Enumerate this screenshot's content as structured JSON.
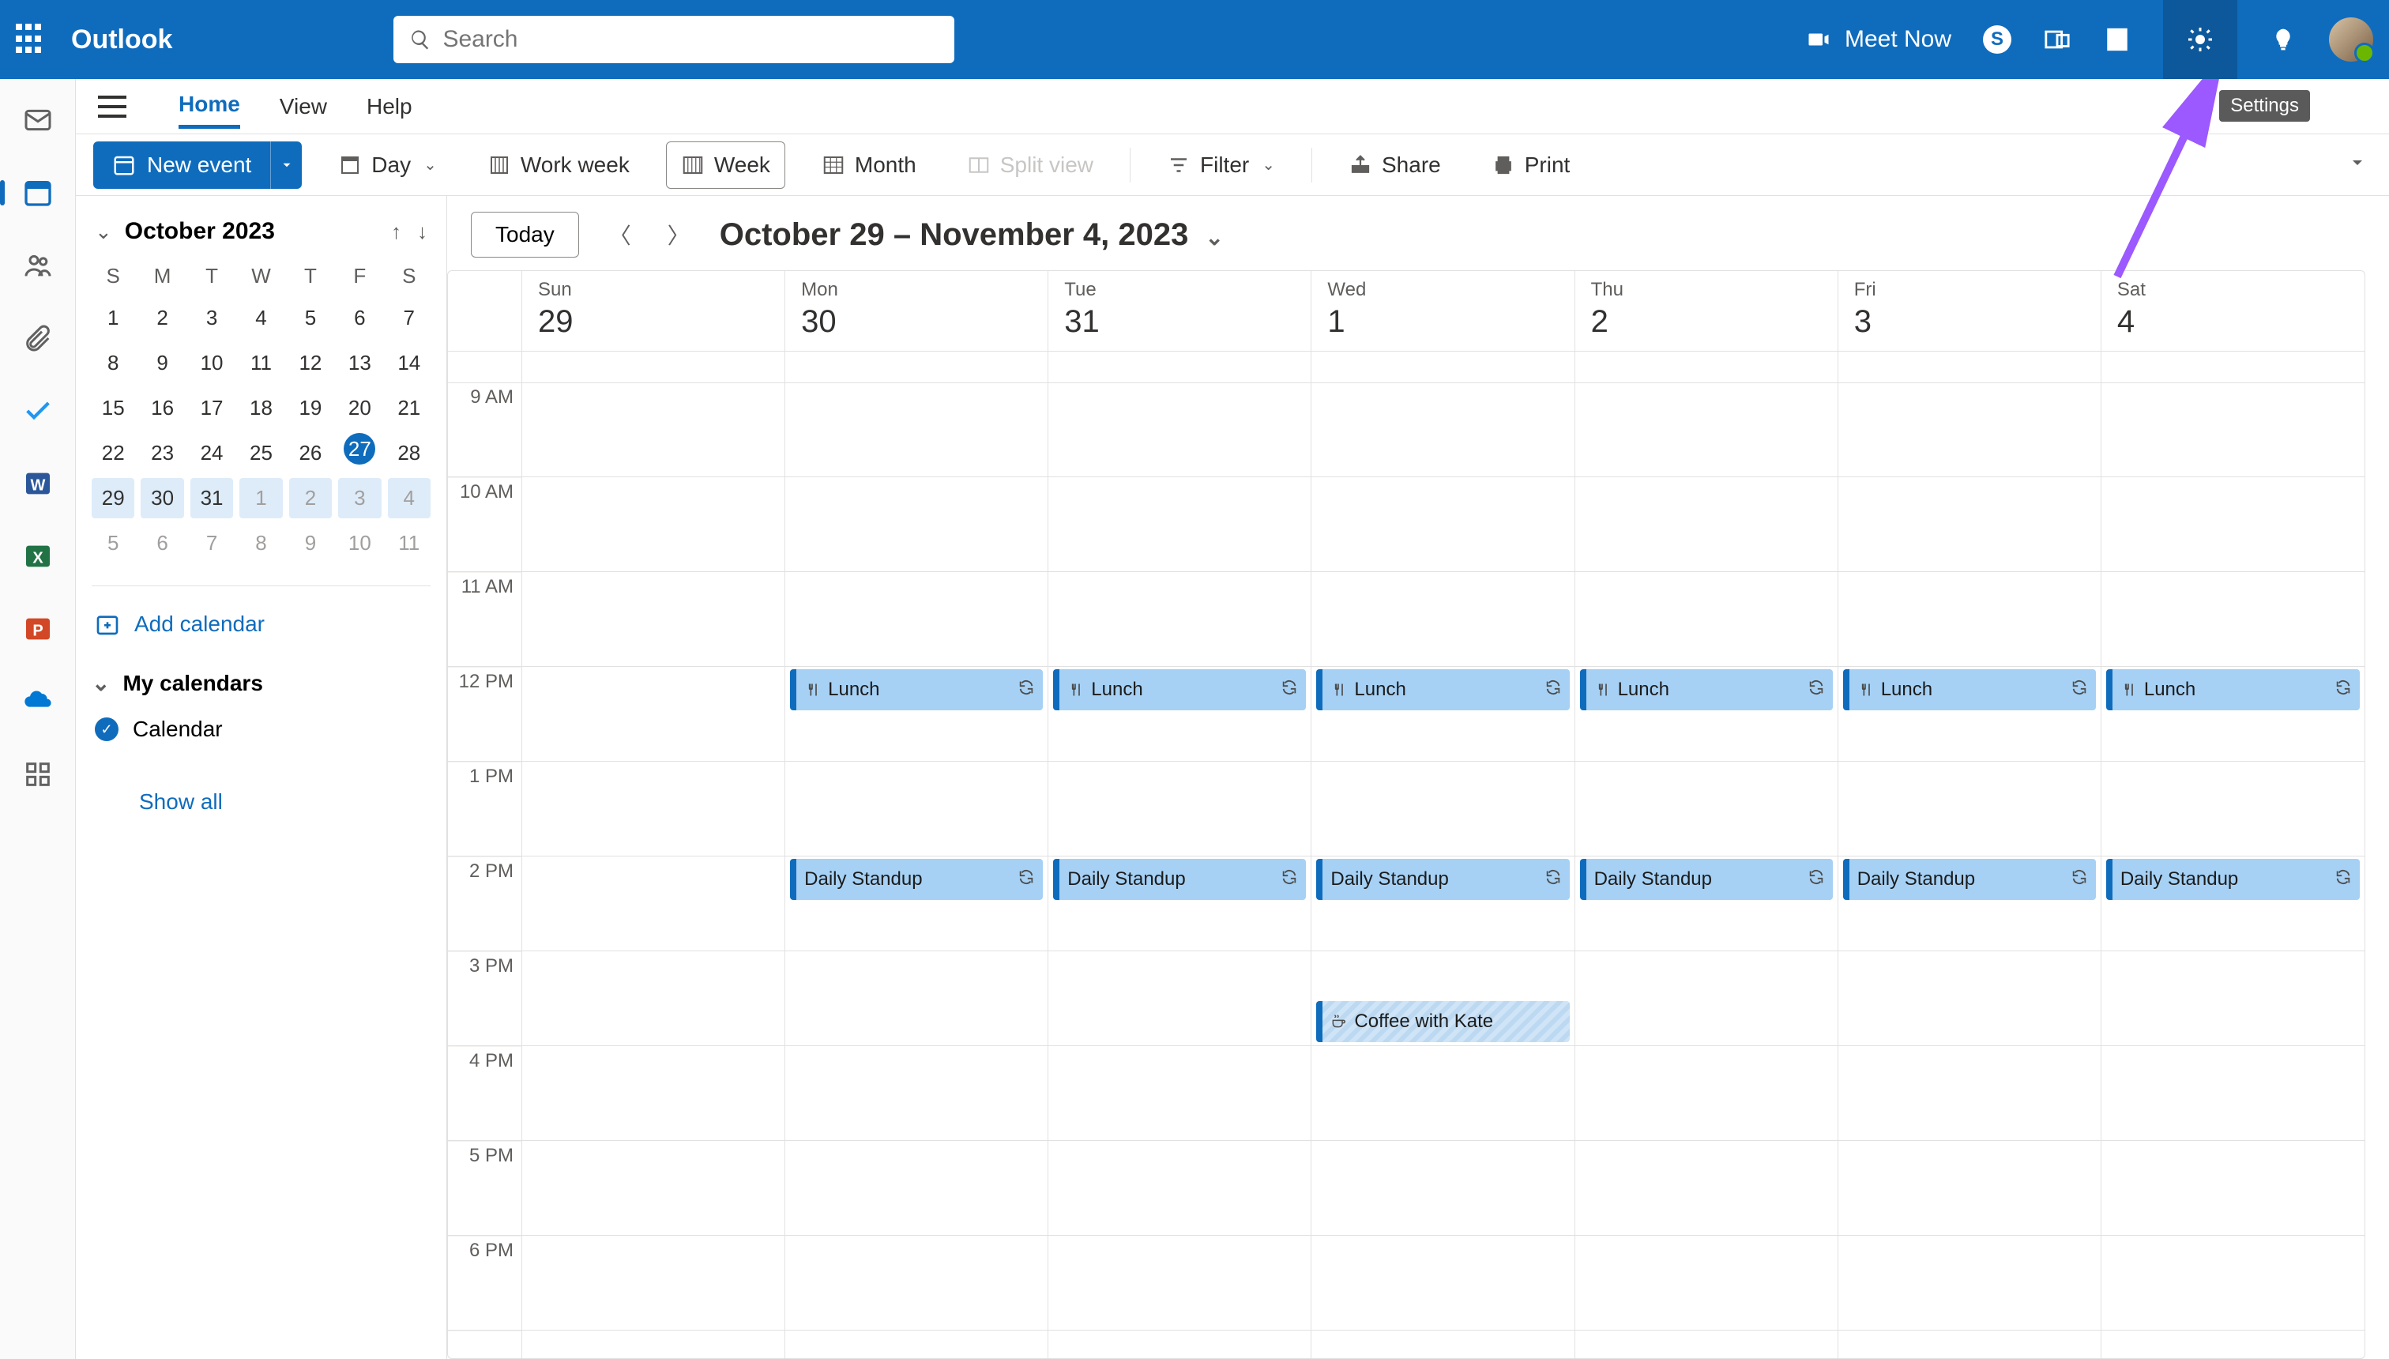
{
  "brand": "Outlook",
  "search": {
    "placeholder": "Search"
  },
  "meetnow_label": "Meet Now",
  "tooltip_settings": "Settings",
  "ribbon": {
    "tabs": [
      "Home",
      "View",
      "Help"
    ],
    "active": "Home"
  },
  "toolbar": {
    "new_event": "New event",
    "day": "Day",
    "workweek": "Work week",
    "week": "Week",
    "month": "Month",
    "splitview": "Split view",
    "filter": "Filter",
    "share": "Share",
    "print": "Print"
  },
  "minicalendar": {
    "month_label": "October 2023",
    "dow": [
      "S",
      "M",
      "T",
      "W",
      "T",
      "F",
      "S"
    ],
    "days": [
      {
        "n": "1"
      },
      {
        "n": "2"
      },
      {
        "n": "3"
      },
      {
        "n": "4"
      },
      {
        "n": "5"
      },
      {
        "n": "6"
      },
      {
        "n": "7"
      },
      {
        "n": "8"
      },
      {
        "n": "9"
      },
      {
        "n": "10"
      },
      {
        "n": "11"
      },
      {
        "n": "12"
      },
      {
        "n": "13"
      },
      {
        "n": "14"
      },
      {
        "n": "15"
      },
      {
        "n": "16"
      },
      {
        "n": "17"
      },
      {
        "n": "18"
      },
      {
        "n": "19"
      },
      {
        "n": "20"
      },
      {
        "n": "21"
      },
      {
        "n": "22"
      },
      {
        "n": "23"
      },
      {
        "n": "24"
      },
      {
        "n": "25"
      },
      {
        "n": "26"
      },
      {
        "n": "27",
        "today": true
      },
      {
        "n": "28"
      },
      {
        "n": "29",
        "range": true
      },
      {
        "n": "30",
        "range": true
      },
      {
        "n": "31",
        "range": true
      },
      {
        "n": "1",
        "other": true,
        "range": true
      },
      {
        "n": "2",
        "other": true,
        "range": true
      },
      {
        "n": "3",
        "other": true,
        "range": true
      },
      {
        "n": "4",
        "other": true,
        "range": true
      },
      {
        "n": "5",
        "other": true
      },
      {
        "n": "6",
        "other": true
      },
      {
        "n": "7",
        "other": true
      },
      {
        "n": "8",
        "other": true
      },
      {
        "n": "9",
        "other": true
      },
      {
        "n": "10",
        "other": true
      },
      {
        "n": "11",
        "other": true
      }
    ],
    "add_calendar": "Add calendar",
    "my_calendars": "My calendars",
    "calendar_item": "Calendar",
    "show_all": "Show all"
  },
  "calendar": {
    "today_label": "Today",
    "range_label": "October 29 – November 4, 2023",
    "days": [
      {
        "dow": "Sun",
        "num": "29"
      },
      {
        "dow": "Mon",
        "num": "30"
      },
      {
        "dow": "Tue",
        "num": "31"
      },
      {
        "dow": "Wed",
        "num": "1"
      },
      {
        "dow": "Thu",
        "num": "2"
      },
      {
        "dow": "Fri",
        "num": "3"
      },
      {
        "dow": "Sat",
        "num": "4"
      }
    ],
    "time_labels": [
      "9 AM",
      "10 AM",
      "11 AM",
      "12 PM",
      "1 PM",
      "2 PM",
      "3 PM",
      "4 PM",
      "5 PM",
      "6 PM"
    ],
    "events": {
      "lunch_title": "Lunch",
      "standup_title": "Daily Standup",
      "coffee_title": "Coffee with Kate"
    }
  }
}
